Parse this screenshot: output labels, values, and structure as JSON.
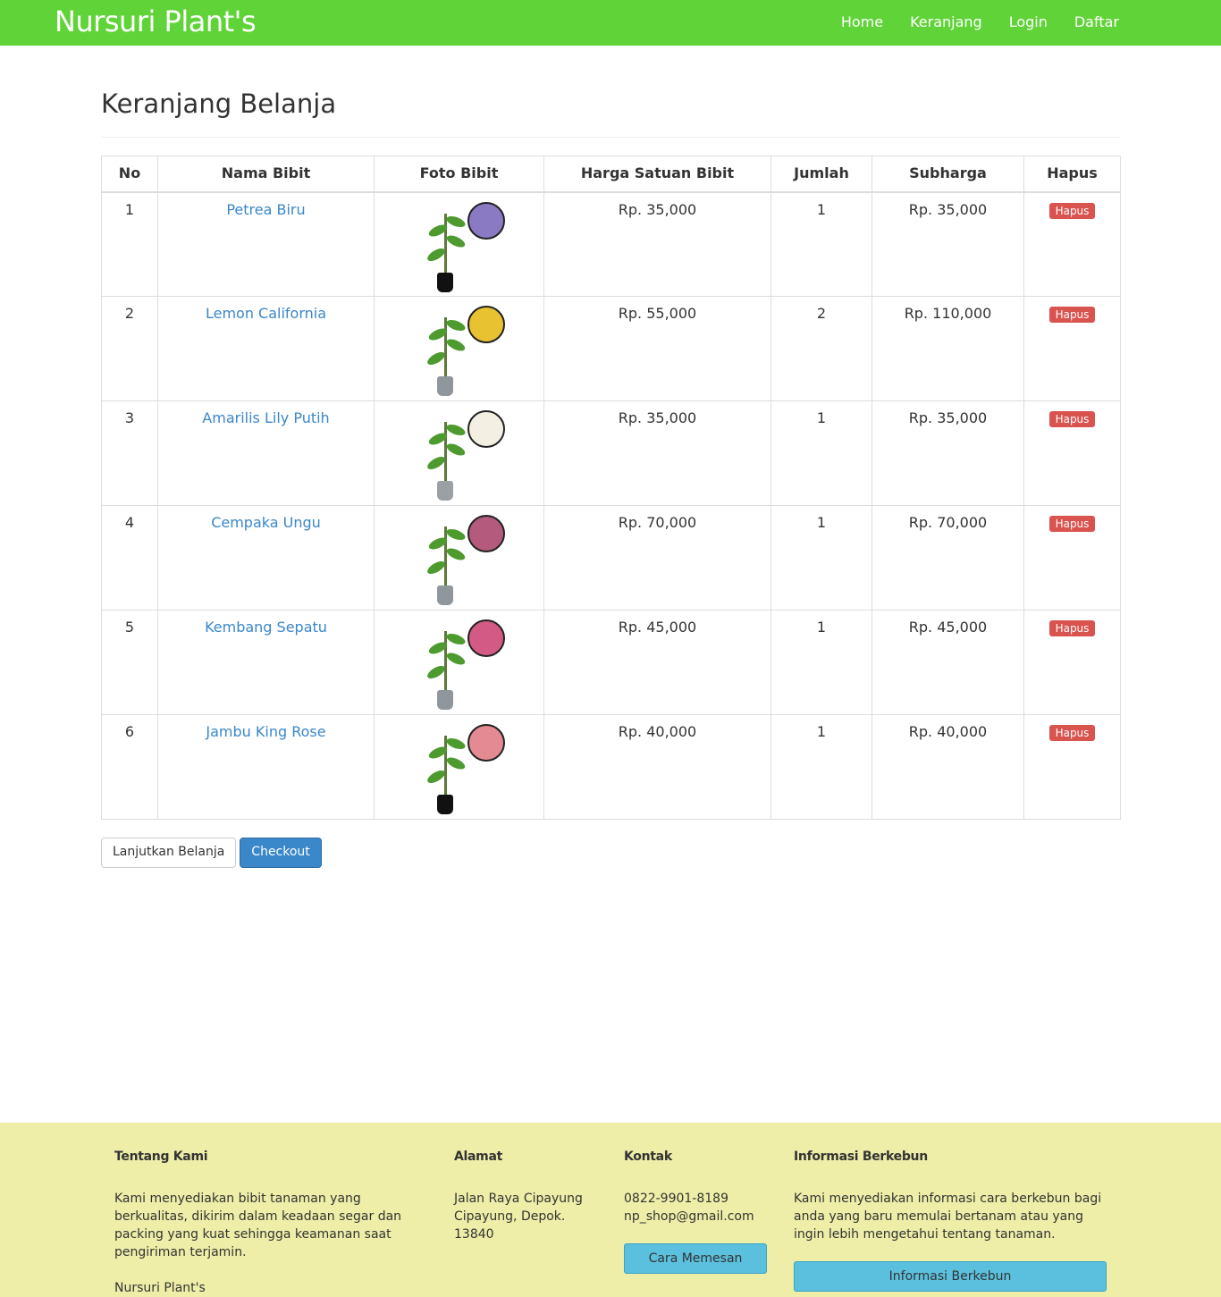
{
  "navbar": {
    "brand": "Nursuri Plant's",
    "links": [
      "Home",
      "Keranjang",
      "Login",
      "Daftar"
    ]
  },
  "page_title": "Keranjang Belanja",
  "table": {
    "headers": [
      "No",
      "Nama Bibit",
      "Foto Bibit",
      "Harga Satuan Bibit",
      "Jumlah",
      "Subharga",
      "Hapus"
    ],
    "rows": [
      {
        "no": "1",
        "name": "Petrea Biru",
        "price": "Rp. 35,000",
        "qty": "1",
        "subtotal": "Rp. 35,000",
        "delete": "Hapus",
        "bloom_color": "#8a7ac4",
        "pot_color": "#111111"
      },
      {
        "no": "2",
        "name": "Lemon California",
        "price": "Rp. 55,000",
        "qty": "2",
        "subtotal": "Rp. 110,000",
        "delete": "Hapus",
        "bloom_color": "#e8c230",
        "pot_color": "#8f979c"
      },
      {
        "no": "3",
        "name": "Amarilis Lily Putih",
        "price": "Rp. 35,000",
        "qty": "1",
        "subtotal": "Rp. 35,000",
        "delete": "Hapus",
        "bloom_color": "#f3f0e3",
        "pot_color": "#9aa0a4"
      },
      {
        "no": "4",
        "name": "Cempaka Ungu",
        "price": "Rp. 70,000",
        "qty": "1",
        "subtotal": "Rp. 70,000",
        "delete": "Hapus",
        "bloom_color": "#b45a7c",
        "pot_color": "#8f979c"
      },
      {
        "no": "5",
        "name": "Kembang Sepatu",
        "price": "Rp. 45,000",
        "qty": "1",
        "subtotal": "Rp. 45,000",
        "delete": "Hapus",
        "bloom_color": "#d45a86",
        "pot_color": "#8f979c"
      },
      {
        "no": "6",
        "name": "Jambu King Rose",
        "price": "Rp. 40,000",
        "qty": "1",
        "subtotal": "Rp. 40,000",
        "delete": "Hapus",
        "bloom_color": "#e38a92",
        "pot_color": "#111111"
      }
    ]
  },
  "buttons": {
    "continue": "Lanjutkan Belanja",
    "checkout": "Checkout"
  },
  "footer": {
    "about": {
      "title": "Tentang Kami",
      "text": "Kami menyediakan bibit tanaman yang berkualitas, dikirim dalam keadaan segar dan packing yang kuat sehingga keamanan saat pengiriman terjamin.",
      "signature": "Nursuri Plant's"
    },
    "address": {
      "title": "Alamat",
      "lines": [
        "Jalan Raya Cipayung",
        "Cipayung, Depok.",
        "13840"
      ]
    },
    "contact": {
      "title": "Kontak",
      "phone": "0822-9901-8189",
      "email": "np_shop@gmail.com",
      "button": "Cara Memesan"
    },
    "info": {
      "title": "Informasi Berkebun",
      "text": "Kami menyediakan informasi cara berkebun bagi anda yang baru memulai bertanam atau yang ingin lebih mengetahui tentang tanaman.",
      "button": "Informasi Berkebun"
    }
  },
  "colors": {
    "navbar": "#5fd338",
    "link": "#3a87c9",
    "danger": "#d9534f",
    "primary": "#3a87c9",
    "footer": "#eeeea8",
    "info_button": "#5bc0de"
  }
}
